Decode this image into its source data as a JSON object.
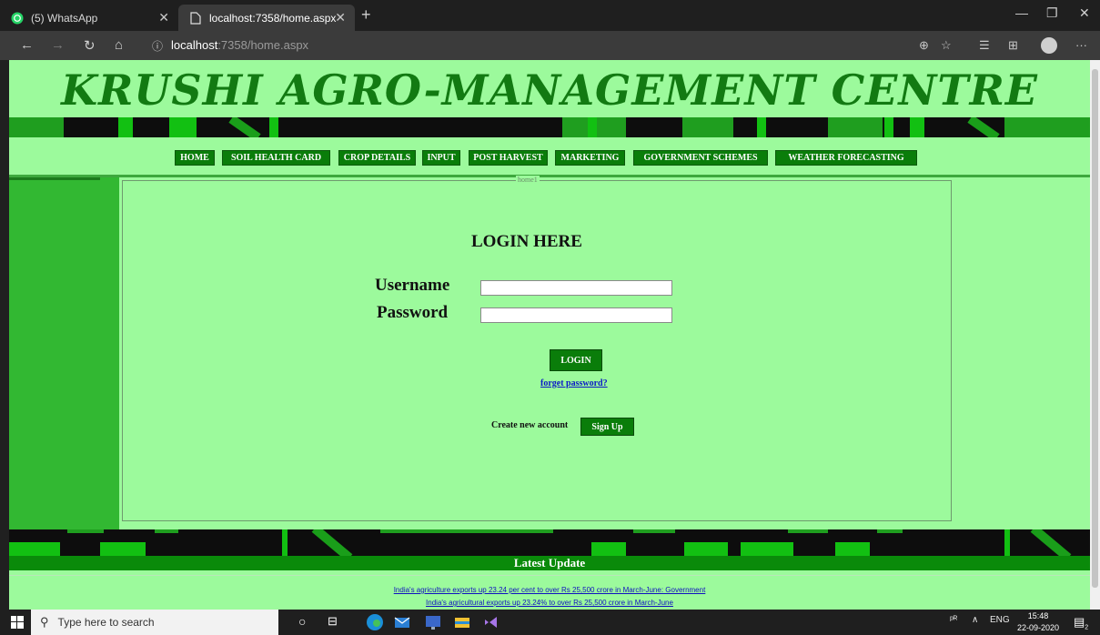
{
  "browser": {
    "tabs": [
      {
        "label": "(5) WhatsApp"
      },
      {
        "label": "localhost:7358/home.aspx"
      }
    ],
    "address": {
      "host": "localhost",
      "rest": ":7358/home.aspx"
    }
  },
  "site": {
    "title": "KRUSHI AGRO-MANAGEMENT CENTRE",
    "menu": [
      {
        "label": "HOME"
      },
      {
        "label": "SOIL HEALTH CARD"
      },
      {
        "label": "CROP DETAILS"
      },
      {
        "label": "INPUT"
      },
      {
        "label": "POST HARVEST"
      },
      {
        "label": "MARKETING"
      },
      {
        "label": "GOVERNMENT SCHEMES"
      },
      {
        "label": "WEATHER FORECASTING"
      }
    ],
    "fieldset_legend": "home1"
  },
  "login": {
    "title": "LOGIN HERE",
    "username_label": "Username",
    "password_label": "Password",
    "username_value": "",
    "password_value": "",
    "login_button": "LOGIN",
    "forgot_link": "forget password?",
    "create_account_label": "Create new account",
    "signup_button": "Sign Up"
  },
  "updates": {
    "header": "Latest Update",
    "items": [
      "India's agriculture exports up 23.24 per cent to over Rs 25,500 crore in March-June: Government",
      "India's agricultural exports up 23.24% to over Rs 25,500 crore in March-June"
    ]
  },
  "taskbar": {
    "search_placeholder": "Type here to search",
    "language": "ENG",
    "time": "15:48",
    "date": "22-09-2020",
    "notification_count": "2"
  },
  "colors": {
    "page_bg": "#9cfa9c",
    "brand_green": "#0a7d0a",
    "title_green": "#127a12"
  }
}
